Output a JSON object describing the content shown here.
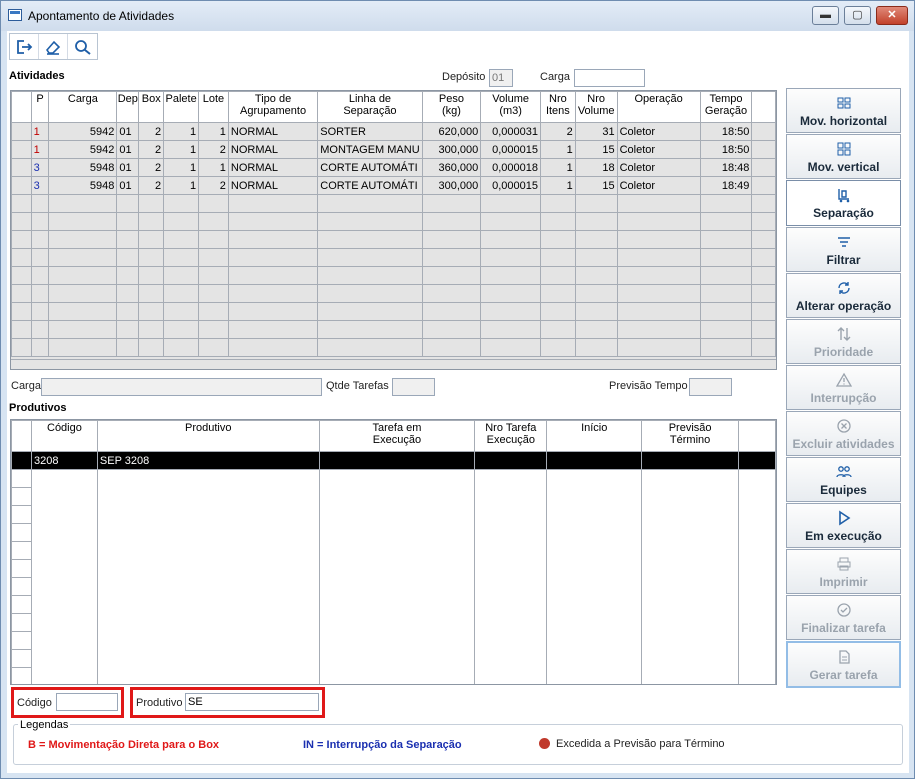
{
  "window": {
    "title": "Apontamento de Atividades",
    "min": "▬",
    "max": "▢",
    "close": "✕"
  },
  "toolbar": {
    "icons": [
      "exit-icon",
      "eraser-icon",
      "search-icon"
    ]
  },
  "atividades": {
    "section_label": "Atividades",
    "deposito_label": "Depósito",
    "deposito_value": "01",
    "carga_label": "Carga",
    "carga_value": "",
    "columns": [
      "",
      "P",
      "Carga",
      "Dep",
      "Box",
      "Palete",
      "Lote",
      "Tipo de\nAgrupamento",
      "Linha de\nSeparação",
      "Peso\n(kg)",
      "Volume\n(m3)",
      "Nro\nItens",
      "Nro\nVolume",
      "Operação",
      "Tempo\nGeração"
    ],
    "rows": [
      {
        "p": "1",
        "p_color": "red",
        "carga": "5942",
        "dep": "01",
        "box": "2",
        "palete": "1",
        "lote": "1",
        "tipo": "NORMAL",
        "linha": "SORTER",
        "peso": "620,000",
        "volume": "0,000031",
        "itens": "2",
        "nvolume": "31",
        "operacao": "Coletor",
        "tempo": "18:50"
      },
      {
        "p": "1",
        "p_color": "red",
        "carga": "5942",
        "dep": "01",
        "box": "2",
        "palete": "1",
        "lote": "2",
        "tipo": "NORMAL",
        "linha": "MONTAGEM MANU",
        "peso": "300,000",
        "volume": "0,000015",
        "itens": "1",
        "nvolume": "15",
        "operacao": "Coletor",
        "tempo": "18:50"
      },
      {
        "p": "3",
        "p_color": "blue",
        "carga": "5948",
        "dep": "01",
        "box": "2",
        "palete": "1",
        "lote": "1",
        "tipo": "NORMAL",
        "linha": "CORTE AUTOMÁTI",
        "peso": "360,000",
        "volume": "0,000018",
        "itens": "1",
        "nvolume": "18",
        "operacao": "Coletor",
        "tempo": "18:48"
      },
      {
        "p": "3",
        "p_color": "blue",
        "carga": "5948",
        "dep": "01",
        "box": "2",
        "palete": "1",
        "lote": "2",
        "tipo": "NORMAL",
        "linha": "CORTE AUTOMÁTI",
        "peso": "300,000",
        "volume": "0,000015",
        "itens": "1",
        "nvolume": "15",
        "operacao": "Coletor",
        "tempo": "18:49"
      }
    ]
  },
  "middle": {
    "carga_label": "Carga",
    "carga_value": "",
    "qtde_label": "Qtde Tarefas",
    "qtde_value": "",
    "previsao_label": "Previsão Tempo",
    "previsao_value": ""
  },
  "produtivos": {
    "section_label": "Produtivos",
    "columns": [
      "",
      "Código",
      "Produtivo",
      "Tarefa em\nExecução",
      "Nro Tarefa\nExecução",
      "Início",
      "Previsão\nTérmino"
    ],
    "rows": [
      {
        "codigo": "3208",
        "produtivo": "SEP 3208",
        "tarefa": "",
        "nro": "",
        "inicio": "",
        "previsao": ""
      }
    ]
  },
  "filters": {
    "codigo_label": "Código",
    "codigo_value": "",
    "produtivo_label": "Produtivo",
    "produtivo_value": "SE"
  },
  "sidebar": {
    "buttons": [
      {
        "label": "Mov. horizontal",
        "icon": "horizontal-move-icon",
        "state": "normal"
      },
      {
        "label": "Mov. vertical",
        "icon": "vertical-move-icon",
        "state": "normal"
      },
      {
        "label": "Separação",
        "icon": "separation-icon",
        "state": "active"
      },
      {
        "label": "Filtrar",
        "icon": "filter-icon",
        "state": "normal"
      },
      {
        "label": "Alterar operação",
        "icon": "refresh-icon",
        "state": "normal"
      },
      {
        "label": "Prioridade",
        "icon": "sort-icon",
        "state": "disabled"
      },
      {
        "label": "Interrupção",
        "icon": "warning-icon",
        "state": "disabled"
      },
      {
        "label": "Excluir atividades",
        "icon": "delete-icon",
        "state": "disabled"
      },
      {
        "label": "Equipes",
        "icon": "team-icon",
        "state": "normal"
      },
      {
        "label": "Em execução",
        "icon": "play-icon",
        "state": "normal"
      },
      {
        "label": "Imprimir",
        "icon": "print-icon",
        "state": "disabled"
      },
      {
        "label": "Finalizar tarefa",
        "icon": "check-icon",
        "state": "disabled"
      },
      {
        "label": "Gerar tarefa",
        "icon": "document-icon",
        "state": "disabled"
      }
    ]
  },
  "legend": {
    "title": "Legendas",
    "b_text": "B = Movimentação Direta para o Box",
    "in_text": "IN = Interrupção da Separação",
    "dot_text": "Excedida a Previsão para Término",
    "colors": {
      "b": "#e01818",
      "in": "#1a2fb0",
      "dot": "#c0392b"
    }
  }
}
